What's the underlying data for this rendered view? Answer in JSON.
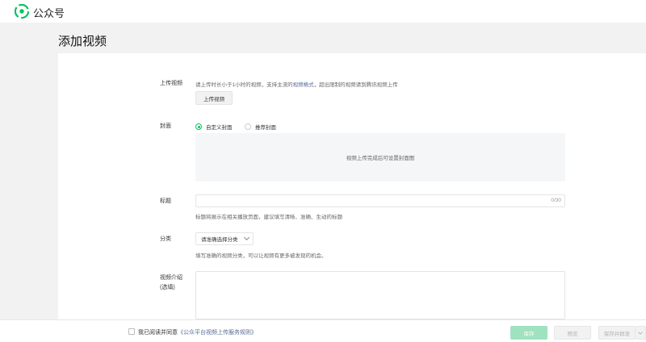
{
  "brand": "公众号",
  "colors": {
    "accent": "#07c160",
    "link": "#576b95"
  },
  "page_title": "添加视频",
  "upload": {
    "label": "上传视频",
    "hint_prefix": "请上传时长小于1小时的视频，支持主流的",
    "hint_link": "视频格式",
    "hint_suffix": "，超出限制的视频请到腾讯视频上传",
    "button": "上传视频"
  },
  "cover": {
    "label": "封面",
    "options": [
      {
        "label": "自定义封面",
        "checked": true
      },
      {
        "label": "推荐封面",
        "checked": false
      }
    ],
    "placeholder": "视频上传完成后可设置封面图"
  },
  "title_field": {
    "label": "标题",
    "counter": "0/30",
    "hint": "标题将展示在相关播放页面，建议填写清晰、准确、生动的标题"
  },
  "category": {
    "label": "分类",
    "selected": "请准确选择分类",
    "hint": "填写准确的视频分类，可以让视频有更多被发现的机会。"
  },
  "intro": {
    "label_line1": "视频介绍",
    "label_line2": "(选填)"
  },
  "footer": {
    "agree_prefix": "我已阅读并同意",
    "agree_link": "《公众平台视频上传服务规则》",
    "save": "保存",
    "preview": "预览",
    "save_publish": "保存并群发"
  },
  "icons": {
    "logo": "wechat-official-accounts-logo-icon",
    "dropdown": "chevron-down-icon"
  }
}
